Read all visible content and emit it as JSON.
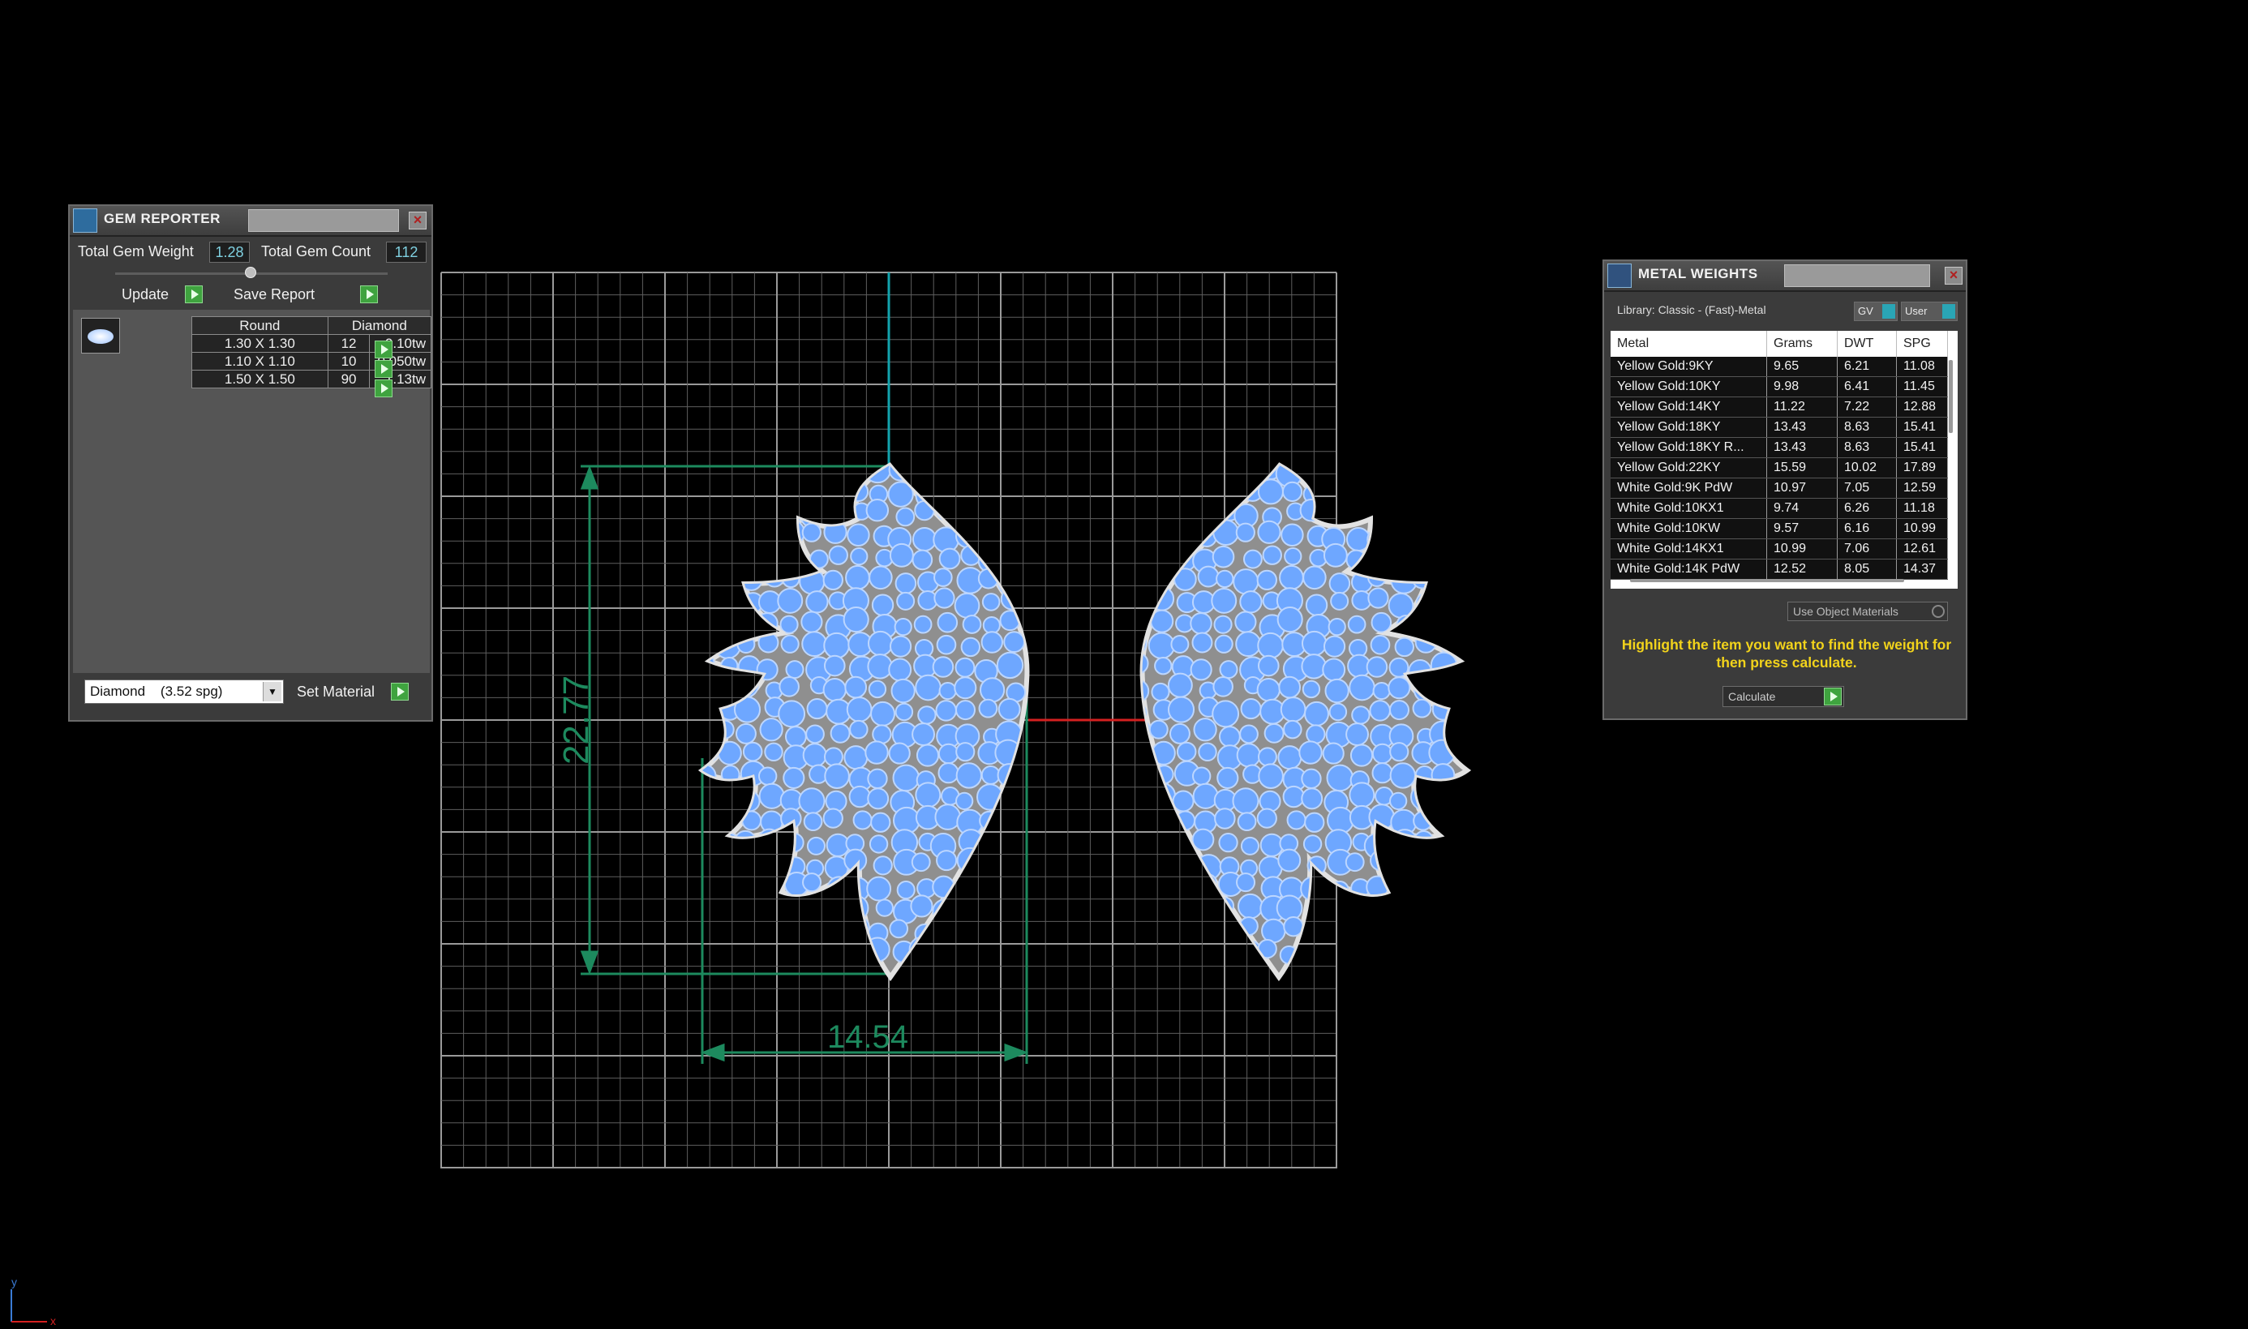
{
  "gem_reporter": {
    "title": "GEM REPORTER",
    "total_weight_label": "Total Gem Weight",
    "total_weight_value": "1.28",
    "total_count_label": "Total Gem Count",
    "total_count_value": "112",
    "update_label": "Update",
    "save_report_label": "Save Report",
    "columns": [
      "Round",
      "Diamond"
    ],
    "rows": [
      {
        "size": "1.30 X 1.30",
        "count": "12",
        "weight": "0.10tw"
      },
      {
        "size": "1.10 X 1.10",
        "count": "10",
        "weight": "0.050tw"
      },
      {
        "size": "1.50 X 1.50",
        "count": "90",
        "weight": "1.13tw"
      }
    ],
    "material_value": "Diamond    (3.52 spg)",
    "set_material_label": "Set Material"
  },
  "metal_weights": {
    "title": "METAL WEIGHTS",
    "library_label": "Library: Classic - (Fast)-Metal",
    "gv_label": "GV",
    "user_label": "User",
    "columns": [
      "Metal",
      "Grams",
      "DWT",
      "SPG"
    ],
    "rows": [
      [
        "Yellow Gold:9KY",
        "9.65",
        "6.21",
        "11.08"
      ],
      [
        "Yellow Gold:10KY",
        "9.98",
        "6.41",
        "11.45"
      ],
      [
        "Yellow Gold:14KY",
        "11.22",
        "7.22",
        "12.88"
      ],
      [
        "Yellow Gold:18KY",
        "13.43",
        "8.63",
        "15.41"
      ],
      [
        "Yellow Gold:18KY R...",
        "13.43",
        "8.63",
        "15.41"
      ],
      [
        "Yellow Gold:22KY",
        "15.59",
        "10.02",
        "17.89"
      ],
      [
        "White Gold:9K PdW",
        "10.97",
        "7.05",
        "12.59"
      ],
      [
        "White Gold:10KX1",
        "9.74",
        "6.26",
        "11.18"
      ],
      [
        "White Gold:10KW",
        "9.57",
        "6.16",
        "10.99"
      ],
      [
        "White Gold:14KX1",
        "10.99",
        "7.06",
        "12.61"
      ],
      [
        "White Gold:14K PdW",
        "12.52",
        "8.05",
        "14.37"
      ]
    ],
    "use_object_materials": "Use Object Materials",
    "hint": "Highlight the item you want to find the weight for then press calculate.",
    "calculate_value": "Calculate"
  },
  "viewport": {
    "dimension_height": "22.77",
    "dimension_width": "14.54",
    "axis_y": "y",
    "axis_x": "x"
  },
  "colors": {
    "grid": "#8a8a8a",
    "gem": "#6ea7ff",
    "metal": "#cfcfcf",
    "dimension": "#1d8a5e",
    "axis_red": "#d42020",
    "axis_teal": "#13a3ad",
    "hint_yellow": "#f2d31b",
    "button_green": "#3fa33f"
  }
}
